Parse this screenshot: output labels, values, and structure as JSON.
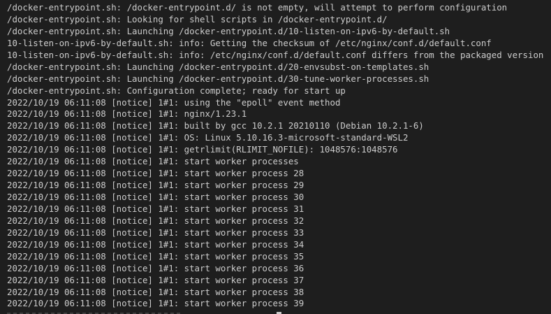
{
  "terminal": {
    "lines": [
      "/docker-entrypoint.sh: /docker-entrypoint.d/ is not empty, will attempt to perform configuration",
      "/docker-entrypoint.sh: Looking for shell scripts in /docker-entrypoint.d/",
      "/docker-entrypoint.sh: Launching /docker-entrypoint.d/10-listen-on-ipv6-by-default.sh",
      "10-listen-on-ipv6-by-default.sh: info: Getting the checksum of /etc/nginx/conf.d/default.conf",
      "10-listen-on-ipv6-by-default.sh: info: /etc/nginx/conf.d/default.conf differs from the packaged version",
      "/docker-entrypoint.sh: Launching /docker-entrypoint.d/20-envsubst-on-templates.sh",
      "/docker-entrypoint.sh: Launching /docker-entrypoint.d/30-tune-worker-processes.sh",
      "/docker-entrypoint.sh: Configuration complete; ready for start up",
      "2022/10/19 06:11:08 [notice] 1#1: using the \"epoll\" event method",
      "2022/10/19 06:11:08 [notice] 1#1: nginx/1.23.1",
      "2022/10/19 06:11:08 [notice] 1#1: built by gcc 10.2.1 20210110 (Debian 10.2.1-6)",
      "2022/10/19 06:11:08 [notice] 1#1: OS: Linux 5.10.16.3-microsoft-standard-WSL2",
      "2022/10/19 06:11:08 [notice] 1#1: getrlimit(RLIMIT_NOFILE): 1048576:1048576",
      "2022/10/19 06:11:08 [notice] 1#1: start worker processes",
      "2022/10/19 06:11:08 [notice] 1#1: start worker process 28",
      "2022/10/19 06:11:08 [notice] 1#1: start worker process 29",
      "2022/10/19 06:11:08 [notice] 1#1: start worker process 30",
      "2022/10/19 06:11:08 [notice] 1#1: start worker process 31",
      "2022/10/19 06:11:08 [notice] 1#1: start worker process 32",
      "2022/10/19 06:11:08 [notice] 1#1: start worker process 33",
      "2022/10/19 06:11:08 [notice] 1#1: start worker process 34",
      "2022/10/19 06:11:08 [notice] 1#1: start worker process 35",
      "2022/10/19 06:11:08 [notice] 1#1: start worker process 36",
      "2022/10/19 06:11:08 [notice] 1#1: start worker process 37",
      "2022/10/19 06:11:08 [notice] 1#1: start worker process 38",
      "2022/10/19 06:11:08 [notice] 1#1: start worker process 39"
    ],
    "colors": {
      "background": "#1e1e1e",
      "foreground": "#cccccc",
      "cursor": "#cccccc"
    }
  }
}
